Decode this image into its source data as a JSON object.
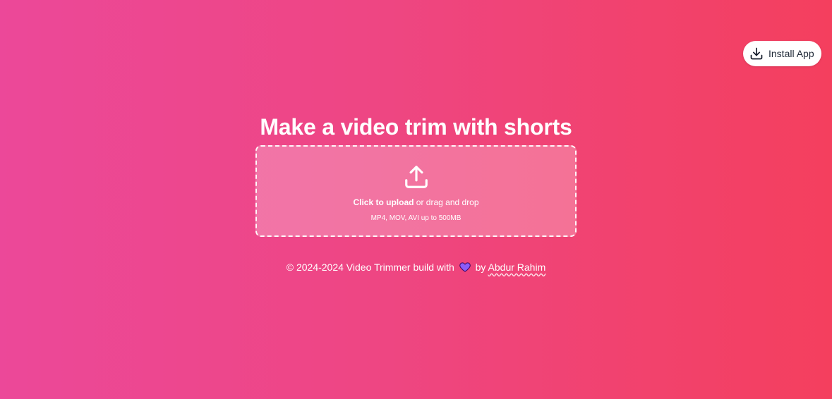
{
  "header": {
    "install_label": "Install App",
    "install_icon": "download-icon"
  },
  "main": {
    "title": "Make a video trim with shorts",
    "upload": {
      "icon": "upload-icon",
      "click_text": "Click to upload",
      "drag_text": " or drag and drop",
      "hint": "MP4, MOV, AVI up to 500MB"
    }
  },
  "footer": {
    "copyright": "© 2024-2024 Video Trimmer build with",
    "heart_icon": "heart-icon",
    "by_text": "by",
    "author": "Abdur Rahim"
  },
  "colors": {
    "gradient_start": "#ec4899",
    "gradient_end": "#f43f5e",
    "heart": "#8b5cf6"
  }
}
